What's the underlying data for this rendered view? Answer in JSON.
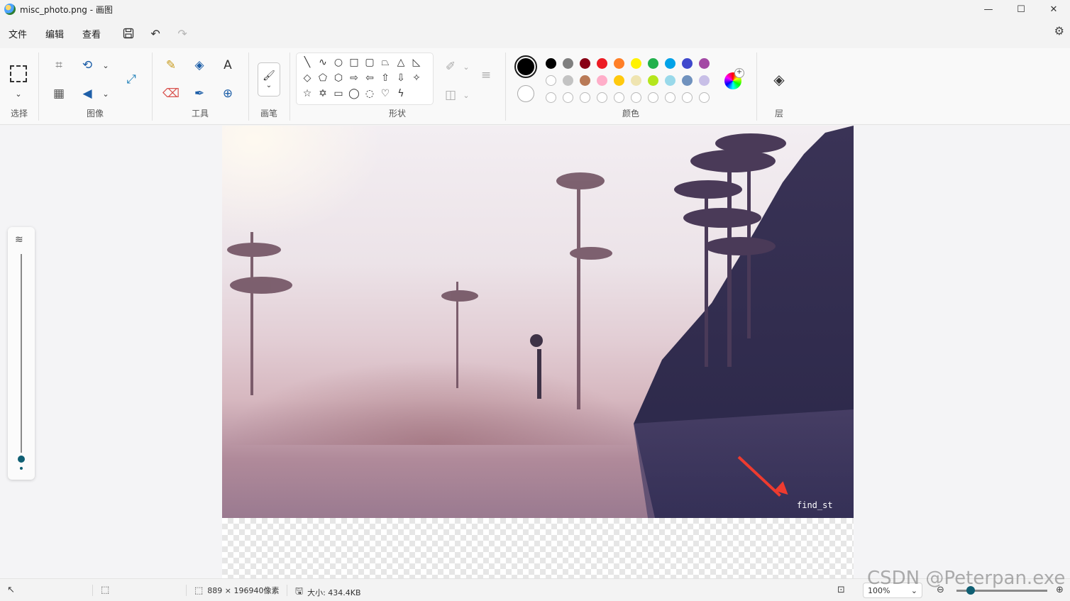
{
  "window": {
    "title": "misc_photo.png - 画图",
    "minimize": "—",
    "maximize": "☐",
    "close": "✕"
  },
  "menu": {
    "file": "文件",
    "edit": "编辑",
    "view": "查看"
  },
  "ribbon": {
    "select_label": "选择",
    "image_label": "图像",
    "tools_label": "工具",
    "brush_label": "画笔",
    "shapes_label": "形状",
    "colors_label": "颜色",
    "layers_label": "层"
  },
  "colors": {
    "primary": "#000000",
    "secondary": "#ffffff",
    "row1": [
      "#000000",
      "#7f7f7f",
      "#880015",
      "#ed1c24",
      "#ff7f27",
      "#fff200",
      "#22b14c",
      "#00a2e8",
      "#3f48cc",
      "#a349a4"
    ],
    "row2": [
      "#ffffff",
      "#c3c3c3",
      "#b97a57",
      "#ffaec9",
      "#ffc90e",
      "#efe4b0",
      "#b5e61d",
      "#99d9ea",
      "#7092be",
      "#c8bfe7"
    ],
    "row3_empty_count": 10,
    "accent": "#0f5f73",
    "arrow": "#ee3b2f"
  },
  "canvas": {
    "label": "find_st"
  },
  "status": {
    "dimensions": "889 × 196940像素",
    "size": "大小: 434.4KB",
    "zoom": "100%"
  },
  "watermark": "CSDN @Peterpan.exe"
}
